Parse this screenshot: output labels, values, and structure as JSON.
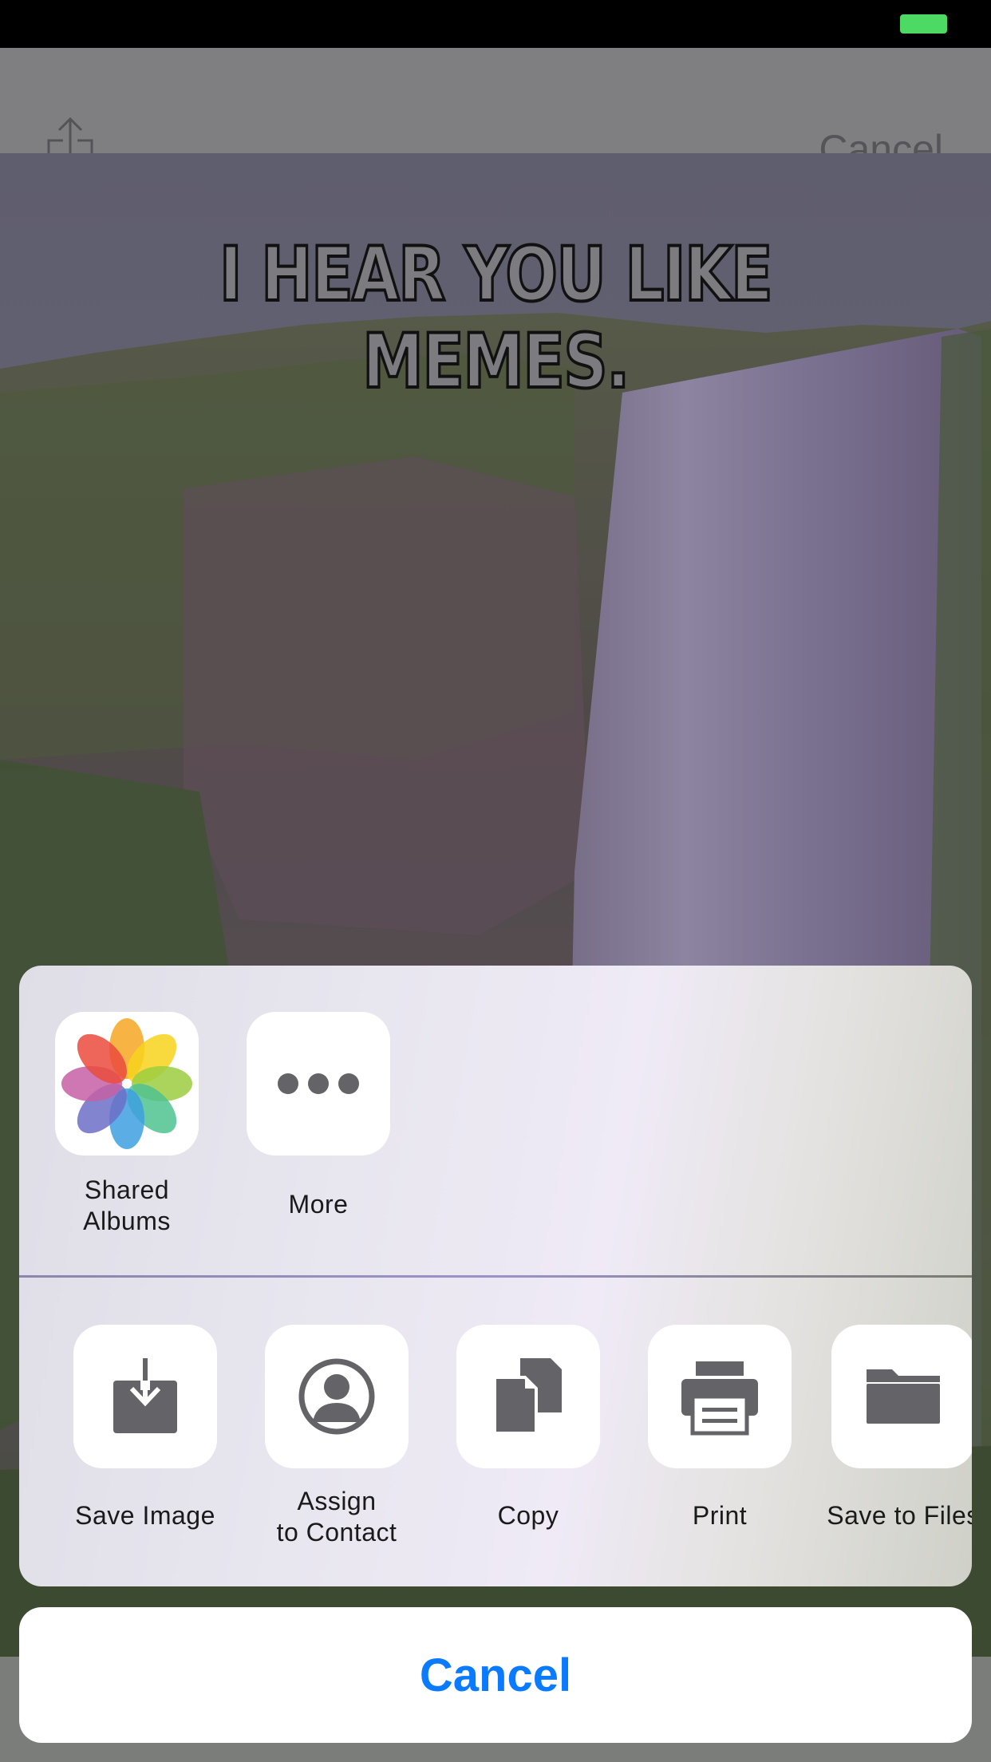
{
  "nav": {
    "cancel_label": "Cancel"
  },
  "meme": {
    "top_text": "I HEAR YOU LIKE MEMES."
  },
  "share_sheet": {
    "apps": [
      {
        "label": "Shared\nAlbums",
        "icon": "photos-icon"
      },
      {
        "label": "More",
        "icon": "more-icon"
      }
    ],
    "actions": [
      {
        "label": "Save Image",
        "icon": "save-image-icon"
      },
      {
        "label": "Assign\nto Contact",
        "icon": "contact-icon"
      },
      {
        "label": "Copy",
        "icon": "copy-icon"
      },
      {
        "label": "Print",
        "icon": "print-icon"
      },
      {
        "label": "Save to Files",
        "icon": "folder-icon"
      }
    ],
    "cancel_label": "Cancel"
  },
  "colors": {
    "accent": "#0a7aff",
    "battery": "#4cd964",
    "icon_gray": "#636368"
  }
}
